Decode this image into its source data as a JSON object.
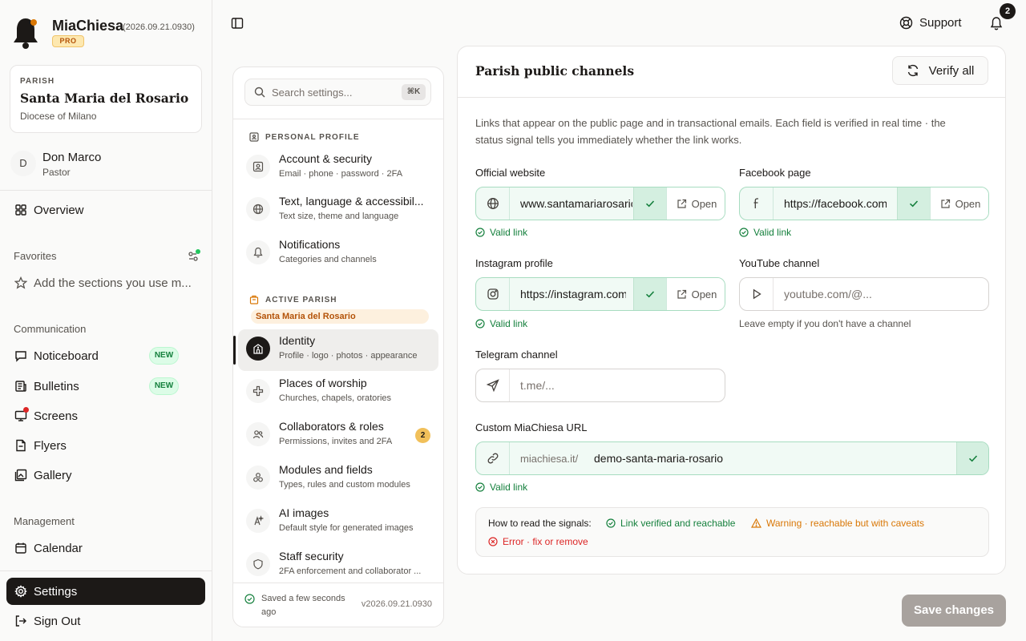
{
  "brand": {
    "name": "MiaChiesa",
    "version": "(2026.09.21.0930)",
    "tier": "PRO",
    "accent": "#d97706"
  },
  "parish": {
    "kicker": "PARISH",
    "name": "Santa Maria del Rosario",
    "diocese": "Diocese of Milano"
  },
  "user": {
    "initial": "D",
    "name": "Don Marco",
    "role": "Pastor"
  },
  "sidebar": {
    "overview": "Overview",
    "favorites_label": "Favorites",
    "favorites_hint": "Add the sections you use m...",
    "communication_label": "Communication",
    "communication": [
      {
        "label": "Noticeboard",
        "badge": "NEW"
      },
      {
        "label": "Bulletins",
        "badge": "NEW"
      },
      {
        "label": "Screens"
      },
      {
        "label": "Flyers"
      },
      {
        "label": "Gallery"
      }
    ],
    "management_label": "Management",
    "calendar": "Calendar",
    "settings": "Settings",
    "sign_out": "Sign Out"
  },
  "topbar": {
    "support": "Support",
    "notifications_count": "2"
  },
  "settings_nav": {
    "search_placeholder": "Search settings...",
    "search_shortcut": "⌘K",
    "personal_label": "PERSONAL PROFILE",
    "personal": [
      {
        "title": "Account & security",
        "sub": "Email · phone · password · 2FA",
        "icon": "user-card-icon"
      },
      {
        "title": "Text, language & accessibil...",
        "sub": "Text size, theme and language",
        "icon": "globe-icon"
      },
      {
        "title": "Notifications",
        "sub": "Categories and channels",
        "icon": "bell-icon"
      }
    ],
    "parish_label": "ACTIVE PARISH",
    "parish_chip": "Santa Maria del Rosario",
    "parish_items": [
      {
        "title": "Identity",
        "sub": "Profile · logo · photos · appearance",
        "icon": "church-icon"
      },
      {
        "title": "Places of worship",
        "sub": "Churches, chapels, oratories",
        "icon": "cross-icon"
      },
      {
        "title": "Collaborators & roles",
        "sub": "Permissions, invites and 2FA",
        "icon": "users-icon",
        "count": "2"
      },
      {
        "title": "Modules and fields",
        "sub": "Types, rules and custom modules",
        "icon": "modules-icon"
      },
      {
        "title": "AI images",
        "sub": "Default style for generated images",
        "icon": "ai-image-icon"
      },
      {
        "title": "Staff security",
        "sub": "2FA enforcement and collaborator ...",
        "icon": "shield-icon"
      }
    ],
    "saved_status": "Saved a few seconds ago",
    "version": "v2026.09.21.0930"
  },
  "main": {
    "title": "Parish public channels",
    "verify_all": "Verify all",
    "description": "Links that appear on the public page and in transactional emails. Each field is verified in real time · the status signal tells you immediately whether the link works.",
    "open_label": "Open",
    "valid_label": "Valid link",
    "fields": {
      "website": {
        "label": "Official website",
        "value": "www.santamariarosario.it"
      },
      "facebook": {
        "label": "Facebook page",
        "value": "https://facebook.com/santamariarosario"
      },
      "instagram": {
        "label": "Instagram profile",
        "value": "https://instagram.com/santamariarosario"
      },
      "youtube": {
        "label": "YouTube channel",
        "placeholder": "youtube.com/@...",
        "hint": "Leave empty if you don't have a channel"
      },
      "telegram": {
        "label": "Telegram channel",
        "placeholder": "t.me/..."
      },
      "custom_url": {
        "label": "Custom MiaChiesa URL",
        "prefix": "miachiesa.it/",
        "value": "demo-santa-maria-rosario"
      }
    },
    "legend": {
      "title": "How to read the signals:",
      "ok": "Link verified and reachable",
      "warn": "Warning · reachable but with caveats",
      "error": "Error · fix or remove"
    },
    "save_changes": "Save changes"
  },
  "colors": {
    "ok": "#15803d",
    "warn": "#d97706",
    "error": "#dc2626",
    "ink": "#1c1917"
  }
}
